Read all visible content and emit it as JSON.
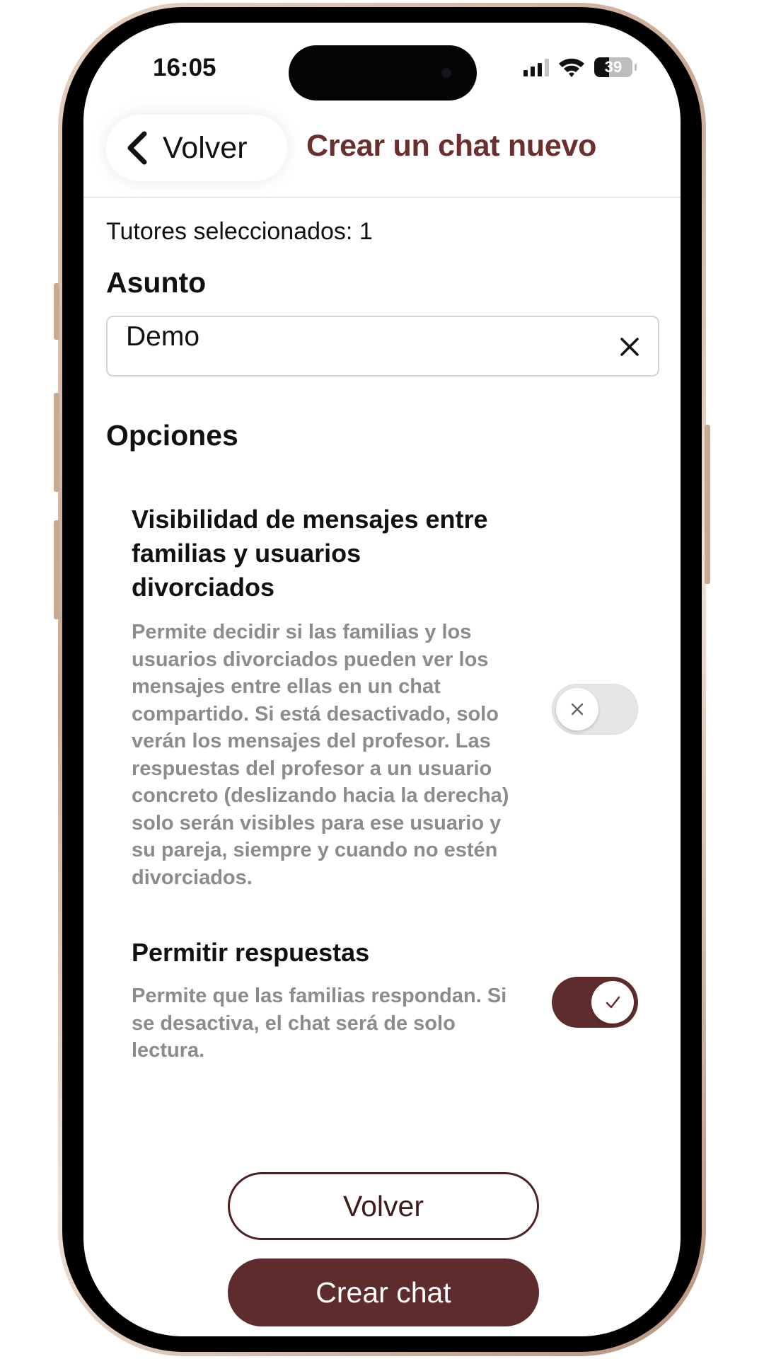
{
  "status_bar": {
    "time": "16:05",
    "battery": "39",
    "icons": [
      "signal-icon",
      "wifi-icon",
      "battery-icon"
    ]
  },
  "header": {
    "back_label": "Volver",
    "title": "Crear un chat nuevo"
  },
  "form": {
    "selected_tutors": "Tutores seleccionados: 1",
    "subject_label": "Asunto",
    "subject_value": "Demo",
    "options_label": "Opciones"
  },
  "options": [
    {
      "title": "Visibilidad de mensajes entre familias y usuarios divorciados",
      "description": "Permite decidir si las familias y los usuarios divorciados pueden ver los mensajes entre ellas en un chat compartido. Si está desactivado, solo verán los mensajes del profesor. Las respuestas del profesor a un usuario concreto (deslizando hacia la derecha) solo serán visibles para ese usuario y su pareja, siempre y cuando no estén divorciados.",
      "enabled": false
    },
    {
      "title": "Permitir respuestas",
      "description": "Permite que las familias respondan. Si se desactiva, el chat será de solo lectura.",
      "enabled": true
    }
  ],
  "actions": {
    "back_label": "Volver",
    "create_label": "Crear chat"
  },
  "colors": {
    "accent": "#5e2c2c",
    "title": "#6b2f2d",
    "muted_text": "#8c8c8c"
  }
}
